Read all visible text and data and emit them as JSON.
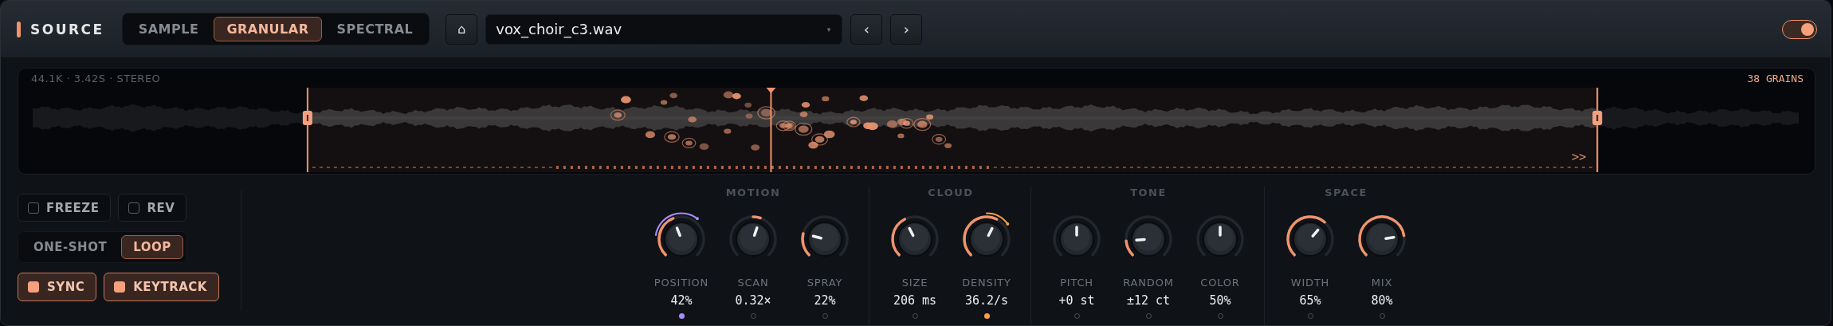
{
  "header": {
    "title": "SOURCE",
    "modes": [
      {
        "label": "SAMPLE",
        "selected": false
      },
      {
        "label": "GRANULAR",
        "selected": true
      },
      {
        "label": "SPECTRAL",
        "selected": false
      }
    ],
    "home_button": "⌂",
    "file": {
      "value": "vox_choir_c3.wav",
      "caret": "▾"
    },
    "prev_button": "‹",
    "next_button": "›",
    "power": {
      "on": true
    }
  },
  "waveform": {
    "info": "44.1K · 3.42S · STEREO",
    "grains": "38 GRAINS",
    "playhead": {
      "level": 0.419
    },
    "follow": ">>"
  },
  "options": {
    "checkboxes": [
      {
        "label": "FREEZE",
        "checked": false
      },
      {
        "label": "REV",
        "checked": false
      }
    ],
    "play_modes": [
      {
        "label": "ONE-SHOT",
        "selected": false
      },
      {
        "label": "LOOP",
        "selected": true
      }
    ],
    "toggles": [
      {
        "label": "SYNC",
        "on": true
      },
      {
        "label": "KEYTRACK",
        "on": true
      }
    ]
  },
  "sections": [
    {
      "title": "MOTION",
      "knobs": [
        {
          "label": "POSITION",
          "value": "42%",
          "kind": "unipolar",
          "mod": {
            "color": "#a78bfa"
          }
        },
        {
          "label": "SCAN",
          "value": "0.32×",
          "kind": "bipolar"
        },
        {
          "label": "SPRAY",
          "value": "22%",
          "kind": "unipolar"
        }
      ]
    },
    {
      "title": "CLOUD",
      "knobs": [
        {
          "label": "SIZE",
          "value": "206 ms",
          "kind": "unipolar"
        },
        {
          "label": "DENSITY",
          "value": "36.2/s",
          "kind": "unipolar",
          "mod": {
            "color": "#f5a142"
          }
        }
      ]
    },
    {
      "title": "TONE",
      "knobs": [
        {
          "label": "PITCH",
          "value": "+0 st",
          "kind": "bipolar"
        },
        {
          "label": "RANDOM",
          "value": "±12 ct",
          "kind": "unipolar"
        },
        {
          "label": "COLOR",
          "value": "50%",
          "kind": "bipolar"
        }
      ]
    },
    {
      "title": "SPACE",
      "knobs": [
        {
          "label": "WIDTH",
          "value": "65%",
          "kind": "unipolar"
        },
        {
          "label": "MIX",
          "value": "80%",
          "kind": "unipolar"
        }
      ]
    }
  ]
}
